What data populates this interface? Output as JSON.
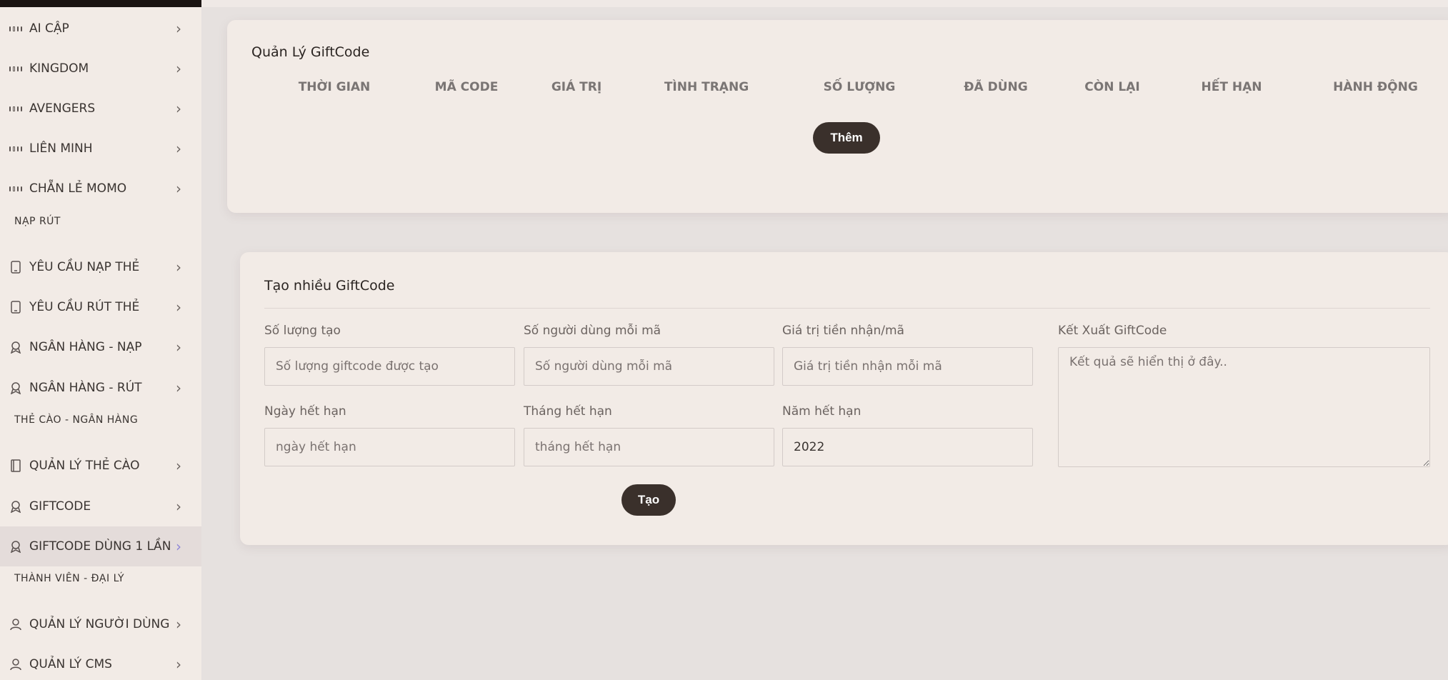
{
  "sidebar": {
    "items": [
      {
        "label": "AI CẬP",
        "icon": "grid-icon"
      },
      {
        "label": "KINGDOM",
        "icon": "grid-icon"
      },
      {
        "label": "AVENGERS",
        "icon": "grid-icon"
      },
      {
        "label": "LIÊN MINH",
        "icon": "grid-icon"
      },
      {
        "label": "CHẴN LẺ MOMO",
        "icon": "grid-icon"
      },
      {
        "label": "YÊU CẦU NẠP THẺ",
        "icon": "tablet-icon"
      },
      {
        "label": "YÊU CẦU RÚT THẺ",
        "icon": "tablet-icon"
      },
      {
        "label": "NGÂN HÀNG - NẠP",
        "icon": "award-icon"
      },
      {
        "label": "NGÂN HÀNG - RÚT",
        "icon": "award-icon"
      },
      {
        "label": "QUẢN LÝ THẺ CÀO",
        "icon": "book-icon"
      },
      {
        "label": "GIFTCODE",
        "icon": "award-icon"
      },
      {
        "label": "GIFTCODE DÙNG 1 LẦN",
        "icon": "award-icon",
        "active": true
      },
      {
        "label": "QUẢN LÝ NGƯỜI DÙNG",
        "icon": "user-icon"
      },
      {
        "label": "QUẢN LÝ CMS",
        "icon": "user-icon"
      }
    ],
    "sections": [
      "NẠP RÚT",
      "THẺ CÀO - NGÂN HÀNG",
      "THÀNH VIÊN - ĐẠI LÝ"
    ],
    "chevron": "›"
  },
  "giftcode_manager": {
    "title": "Quản Lý GiftCode",
    "columns": [
      "THỜI GIAN",
      "MÃ CODE",
      "GIÁ TRỊ",
      "TÌNH TRẠNG",
      "SỐ LƯỢNG",
      "ĐÃ DÙNG",
      "CÒN LẠI",
      "HẾT HẠN",
      "HÀNH ĐỘNG"
    ],
    "add_label": "Thêm"
  },
  "create_form": {
    "title": "Tạo nhiều GiftCode",
    "fields": [
      {
        "label": "Số lượng tạo",
        "placeholder": "Số lượng giftcode được tạo",
        "value": ""
      },
      {
        "label": "Số người dùng mỗi mã",
        "placeholder": "Số người dùng mỗi mã",
        "value": ""
      },
      {
        "label": "Giá trị tiền nhận/mã",
        "placeholder": "Giá trị tiền nhận mỗi mã",
        "value": ""
      },
      {
        "label": "Ngày hết hạn",
        "placeholder": "ngày hết hạn",
        "value": ""
      },
      {
        "label": "Tháng hết hạn",
        "placeholder": "tháng hết hạn",
        "value": ""
      },
      {
        "label": "Năm hết hạn",
        "placeholder": "",
        "value": "2022"
      }
    ],
    "export": {
      "label": "Kết Xuất GiftCode",
      "placeholder": "Kết quả sẽ hiển thị ở đây.."
    },
    "submit_label": "Tạo"
  },
  "colors": {
    "accent_dark": "#3a302b",
    "active_chevron": "#8e86d8"
  }
}
